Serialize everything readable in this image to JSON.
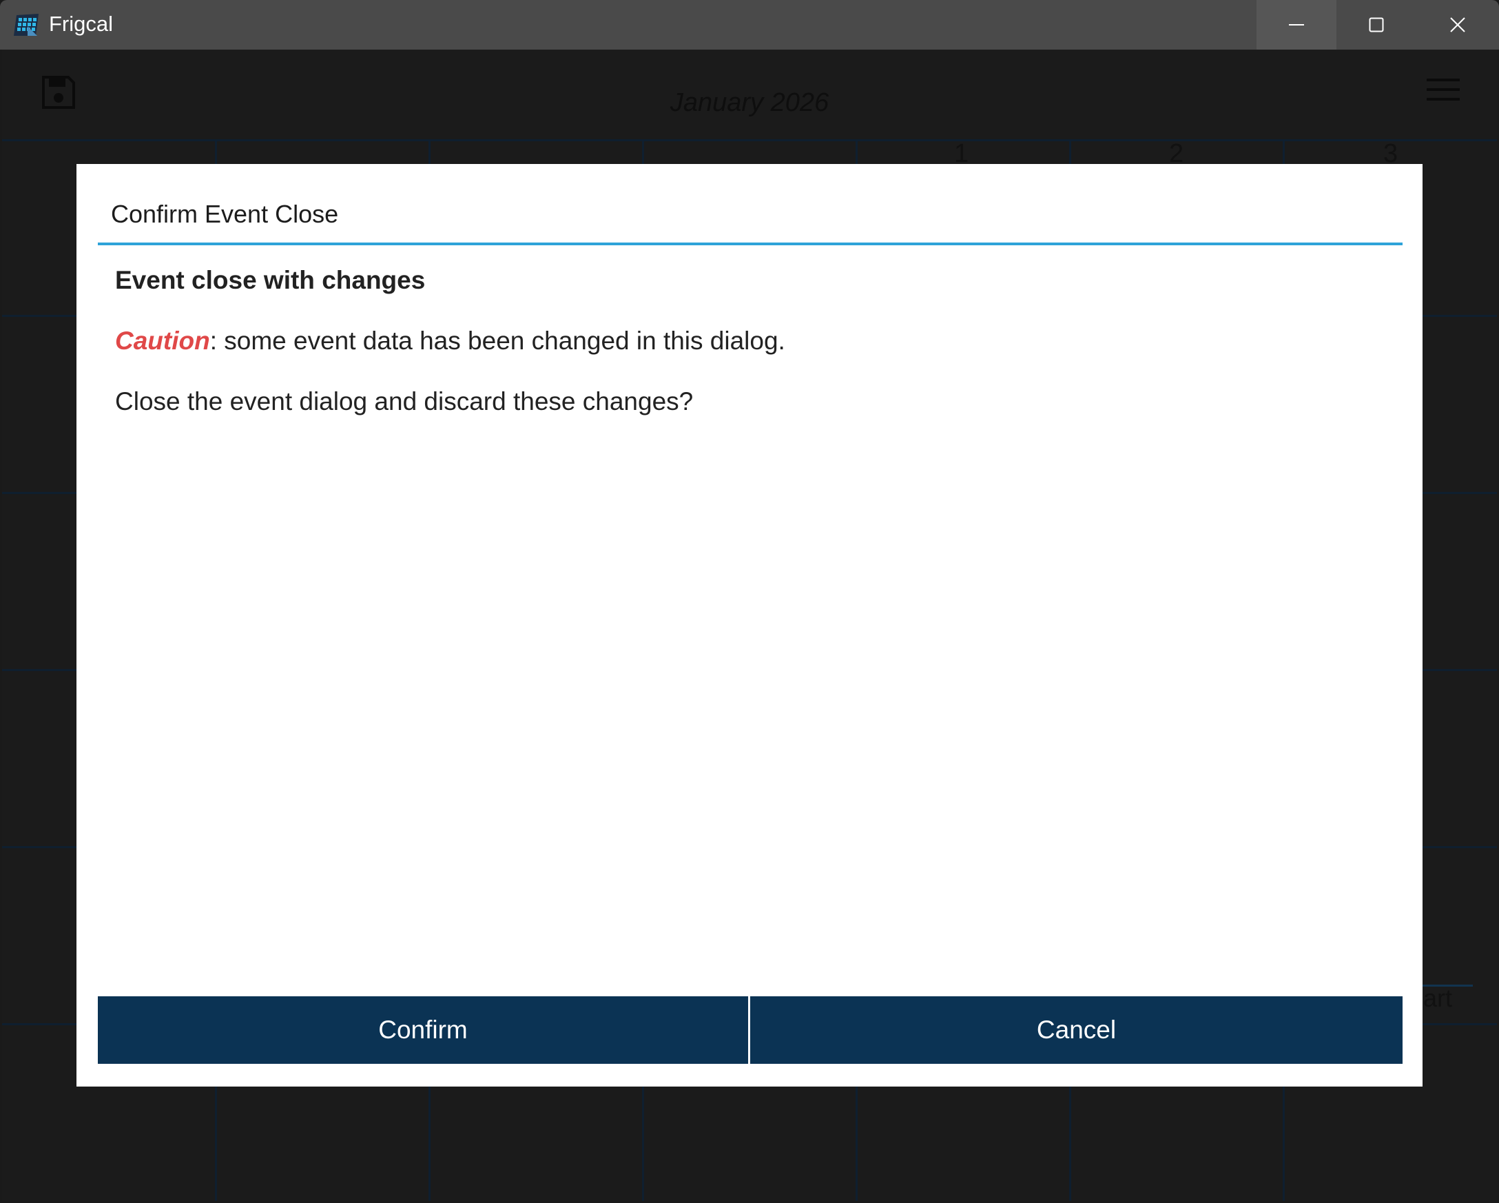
{
  "window": {
    "title": "Frigcal",
    "icon": "frigcal-app-icon",
    "controls": [
      "minimize-icon",
      "maximize-icon",
      "close-icon"
    ]
  },
  "calendar": {
    "month_title": "January 2026",
    "visible_day_numbers": [
      "1",
      "2",
      "3"
    ],
    "partial_event_text": "art",
    "colors": {
      "background": "#1b1b1b",
      "grid_lines": "#0f1f2f"
    }
  },
  "dialog": {
    "title": "Confirm Event Close",
    "heading": "Event close with changes",
    "caution_word": "Caution",
    "caution_text": ": some event data has been changed in this dialog.",
    "question": "Close the event dialog and discard these changes?",
    "confirm_label": "Confirm",
    "cancel_label": "Cancel",
    "colors": {
      "divider": "#2ea3d9",
      "caution": "#e04848",
      "button_bg": "#0b3354",
      "button_text": "#ffffff"
    }
  }
}
